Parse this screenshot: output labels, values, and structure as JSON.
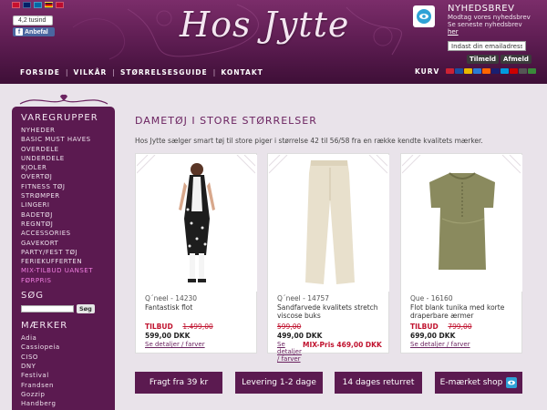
{
  "header": {
    "flags": [
      {
        "name": "denmark-flag-icon",
        "color": "#c8102e"
      },
      {
        "name": "uk-flag-icon",
        "color": "#012169"
      },
      {
        "name": "sweden-flag-icon",
        "color": "#006aa7"
      },
      {
        "name": "germany-flag-icon",
        "color": "#222222"
      },
      {
        "name": "norway-flag-icon",
        "color": "#ba0c2f"
      }
    ],
    "like_count": "4,2 tusind",
    "like_button": "Anbefal",
    "logo": "Hos Jytte",
    "newsletter": {
      "title": "NYHEDSBREV",
      "text": "Modtag vores nyhedsbrev",
      "text2": "Se seneste nyhedsbrev",
      "here": "her",
      "placeholder": "Indast din emailadresse",
      "subscribe": "Tilmeld",
      "unsubscribe": "Afmeld"
    },
    "nav": [
      {
        "label": "FORSIDE",
        "name": "nav-forside"
      },
      {
        "label": "VILKÅR",
        "name": "nav-vilkar"
      },
      {
        "label": "STØRRELSESGUIDE",
        "name": "nav-storrelsesguide"
      },
      {
        "label": "KONTAKT",
        "name": "nav-kontakt"
      }
    ],
    "cart": "KURV",
    "cards": [
      "#cc2233",
      "#1a4fa0",
      "#e8b800",
      "#2a7bd4",
      "#ff6600",
      "#1a1f71",
      "#009bde",
      "#cc0000",
      "#555555",
      "#3a8a3a"
    ]
  },
  "sidebar": {
    "categories_title": "VAREGRUPPER",
    "categories": [
      "NYHEDER",
      "BASIC MUST HAVES",
      "OVERDELE",
      "UNDERDELE",
      "KJOLER",
      "OVERTØJ",
      "FITNESS TØJ",
      "STRØMPER",
      "LINGERI",
      "BADETØJ",
      "REGNTØJ",
      "ACCESSORIES",
      "GAVEKORT",
      "PARTY/FEST TØJ",
      "FERIEKUFFERTEN"
    ],
    "highlight": [
      "MIX-TILBUD UANSET",
      "FØRPRIS"
    ],
    "search_title": "SØG",
    "search_button": "Søg",
    "brands_title": "MÆRKER",
    "brands": [
      "Adia",
      "Cassiopeia",
      "CISO",
      "DNY",
      "Festival",
      "Frandsen",
      "Gozzip",
      "Handberg"
    ]
  },
  "main": {
    "title": "DAMETØJ I STORE STØRRELSER",
    "intro": "Hos Jytte sælger smart tøj til store piger i størrelse 42 til 56/58 fra en række kendte kvalitets mærker.",
    "products": [
      {
        "brand": "Q´neel - 14230",
        "name": "Fantastisk flot",
        "line1_label": "TILBUD",
        "line1_old": "1.499,00",
        "price": "599,00 DKK",
        "details": "Se detaljer / farver"
      },
      {
        "brand": "Q´neel - 14757",
        "name": "Sandfarvede kvalitets stretch viscose buks",
        "line1_label": "",
        "line1_old": "599,00",
        "price": "499,00 DKK",
        "details": "Se detaljer / farver",
        "mix": "MIX-Pris 469,00 DKK"
      },
      {
        "brand": "Que - 16160",
        "name": "Flot blank tunika med korte draperbare ærmer",
        "line1_label": "TILBUD",
        "line1_old": "799,00",
        "price": "699,00 DKK",
        "details": "Se detaljer / farver"
      }
    ],
    "features": [
      "Fragt fra 39 kr",
      "Levering 1-2 dage",
      "14 dages returret",
      "E-mærket shop"
    ]
  }
}
